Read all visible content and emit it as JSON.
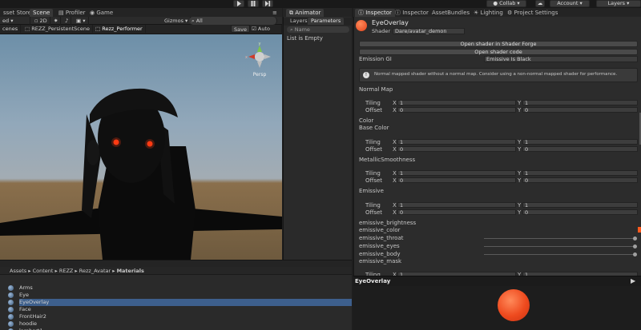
{
  "toolbar": {
    "collab": "Collab",
    "account": "Account",
    "layers": "Layers",
    "play_icon": "play-icon",
    "pause_icon": "pause-icon",
    "step_icon": "step-icon"
  },
  "scene_tabs": [
    "sset Store",
    "Scene",
    "Profiler",
    "Game"
  ],
  "scene_toolbar": {
    "shading": "ed",
    "mode_2d": "2D",
    "gizmos": "Gizmos",
    "search": "All"
  },
  "scene_breadcrumb": {
    "item0": "cenes",
    "item1": "REZZ_PersistentScene",
    "item2": "Rezz_Performer",
    "save": "Save",
    "auto_save": "Auto Save"
  },
  "gizmo": {
    "label": "Persp",
    "x": "x",
    "y": "y"
  },
  "animator": {
    "tab": "Animator",
    "layers_tab": "Layers",
    "parameters_tab": "Parameters",
    "search_placeholder": "Name",
    "empty": "List is Empty"
  },
  "inspector_tabs": [
    "Inspector",
    "Inspector",
    "AssetBundles",
    "Lighting",
    "Project Settings"
  ],
  "inspector": {
    "material_name": "EyeOverlay",
    "shader_label": "Shader",
    "shader_value": "Dare/avatar_demon",
    "open_shader_forge": "Open shader in Shader Forge",
    "open_shader_code": "Open shader code",
    "emission_gi_label": "Emission GI",
    "emission_gi_value": "Emissive Is Black",
    "warning": "Normal mapped shader without a normal map. Consider using a non-normal mapped shader for performance.",
    "normal_map": "Normal Map",
    "color": "Color",
    "base_color": "Base Color",
    "metallic": "MetallicSmoothness",
    "emissive": "Emissive",
    "tiling": "Tiling",
    "offset": "Offset",
    "x": "X",
    "y": "Y",
    "one": "1",
    "zero": "0",
    "props": [
      "emissive_brightness",
      "emissive_color",
      "emissive_throat",
      "emissive_eyes",
      "emissive_body",
      "emissive_mask"
    ]
  },
  "preview": {
    "title": "EyeOverlay"
  },
  "project": {
    "breadcrumb": [
      "Assets",
      "Content",
      "REZZ",
      "Rezz_Avatar",
      "Materials"
    ],
    "items": [
      "Arms",
      "Eye",
      "EyeOverlay",
      "Face",
      "FrontHair2",
      "hoodie",
      "lambert1"
    ],
    "selected": "EyeOverlay"
  },
  "colors": {
    "accent_orange": "#ff5a1e",
    "selection_blue": "#3d5f8c",
    "eye_glow": "#ff3a12"
  }
}
